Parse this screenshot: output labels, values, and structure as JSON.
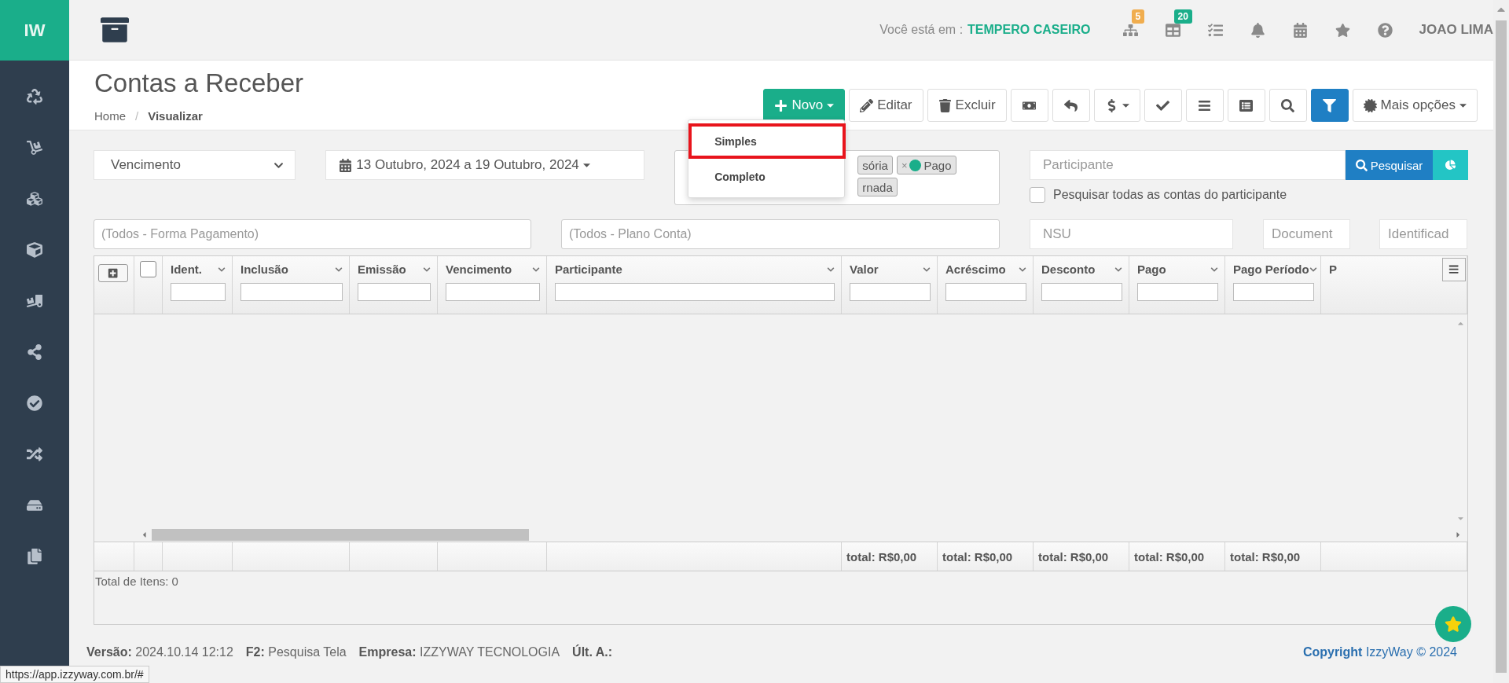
{
  "sidebar": {
    "logo": "IW"
  },
  "header": {
    "location_label": "Você está em :",
    "location": "TEMPERO CASEIRO",
    "badges": [
      {
        "count": "5",
        "color": "#f0ad4e"
      },
      {
        "count": "20",
        "color": "#1aae8a"
      }
    ],
    "user": "JOAO LIMA"
  },
  "page": {
    "title": "Contas a Receber",
    "separator": "/",
    "breadcrumb": [
      {
        "label": "Home",
        "current": false
      },
      {
        "label": "Visualizar",
        "current": true
      }
    ]
  },
  "toolbar": {
    "buttons": [
      {
        "label": "Novo",
        "kind": "primary",
        "caret": true
      },
      {
        "label": "Editar",
        "kind": "default",
        "caret": false
      },
      {
        "label": "Excluir",
        "kind": "default",
        "caret": false
      },
      {
        "kind": "default",
        "caret": false
      },
      {
        "kind": "default",
        "caret": false
      },
      {
        "kind": "default",
        "caret": true
      },
      {
        "kind": "default",
        "caret": false
      },
      {
        "kind": "default",
        "caret": false
      },
      {
        "kind": "default",
        "caret": false
      },
      {
        "kind": "default",
        "caret": false
      },
      {
        "kind": "active",
        "caret": false
      },
      {
        "label": "Mais opções",
        "kind": "default",
        "caret": true
      }
    ]
  },
  "new_menu": {
    "items": [
      {
        "label": "Simples",
        "selected": true
      },
      {
        "label": "Completo",
        "selected": false
      }
    ]
  },
  "filters": {
    "date_field": "Vencimento",
    "date_range": "13 Outubro, 2024 a 19 Outubro, 2024",
    "status_rows": [
      [
        {
          "label": "sória"
        },
        {
          "label": "Pago",
          "remove": "×",
          "color": "#1aae8a"
        }
      ],
      [
        {
          "label": "rnada"
        }
      ]
    ],
    "participant_placeholder": "Participante",
    "search_button": "Pesquisar",
    "search_all": {
      "label": "Pesquisar todas as contas do participante",
      "checked": false
    },
    "payment_placeholder": "(Todos - Forma Pagamento)",
    "plan_placeholder": "(Todos - Plano Conta)",
    "nsu_placeholder": "NSU",
    "document_placeholder": "Document",
    "ident_placeholder": "Identificad"
  },
  "table": {
    "select_all_checked": false,
    "columns": [
      {
        "label": "Ident."
      },
      {
        "label": "Inclusão"
      },
      {
        "label": "Emissão"
      },
      {
        "label": "Vencimento"
      },
      {
        "label": "Participante"
      },
      {
        "label": "Valor",
        "total": "total: R$0,00"
      },
      {
        "label": "Acréscimo",
        "total": "total: R$0,00"
      },
      {
        "label": "Desconto",
        "total": "total: R$0,00"
      },
      {
        "label": "Pago",
        "total": "total: R$0,00"
      },
      {
        "label": "Pago Período",
        "total": "total: R$0,00"
      },
      {
        "label": "P"
      }
    ],
    "total_items": "Total de Itens: 0"
  },
  "footer": {
    "version_label": "Versão:",
    "version": "2024.10.14 12:12",
    "f2_label": "F2:",
    "f2": "Pesquisa Tela",
    "company_label": "Empresa:",
    "company": "IZZYWAY TECNOLOGIA",
    "last_label": "Últ. A.:",
    "copyright_label": "Copyright",
    "copyright": "IzzyWay © 2024"
  },
  "status_url": "https://app.izzyway.com.br/#"
}
